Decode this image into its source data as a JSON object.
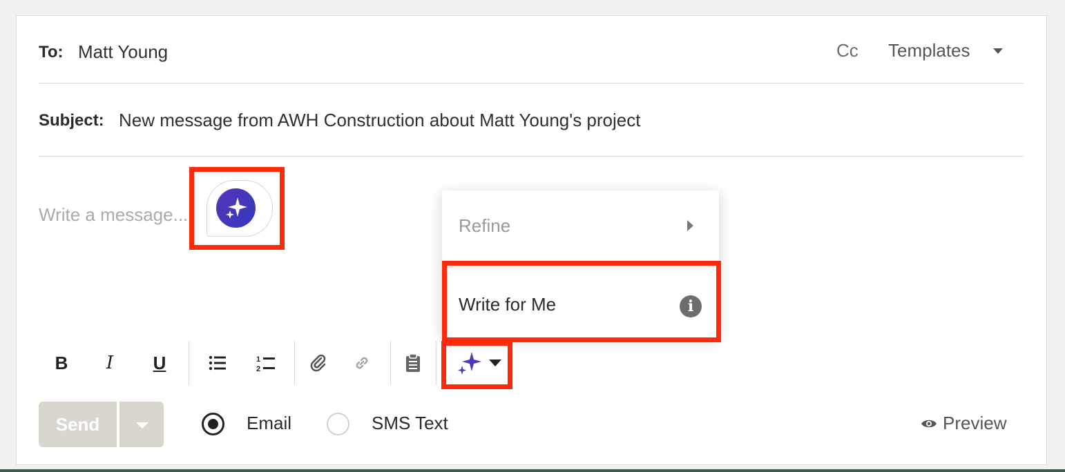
{
  "compose": {
    "to_label": "To:",
    "to_value": "Matt Young",
    "cc_label": "Cc",
    "templates_label": "Templates",
    "subject_label": "Subject:",
    "subject_value": "New message from AWH Construction about Matt Young's project",
    "body_placeholder": "Write a message..."
  },
  "ai_menu": {
    "items": [
      {
        "label": "Refine",
        "icon": "chevron-right-icon",
        "enabled": false
      },
      {
        "label": "Write for Me",
        "icon": "info-icon",
        "enabled": true
      }
    ]
  },
  "toolbar": {
    "buttons": [
      {
        "name": "bold-button",
        "glyph": "B"
      },
      {
        "name": "italic-button",
        "glyph": "I"
      },
      {
        "name": "underline-button",
        "glyph": "U"
      },
      {
        "name": "bullet-list-button",
        "icon": "bullet-list-icon"
      },
      {
        "name": "numbered-list-button",
        "icon": "numbered-list-icon"
      },
      {
        "name": "attach-button",
        "icon": "paperclip-icon"
      },
      {
        "name": "link-button",
        "icon": "link-icon"
      },
      {
        "name": "clipboard-button",
        "icon": "clipboard-icon"
      },
      {
        "name": "ai-sparkle-button",
        "icon": "sparkle-icon"
      }
    ]
  },
  "footer": {
    "send_label": "Send",
    "channel_options": [
      "Email",
      "SMS Text"
    ],
    "selected_channel": "Email",
    "preview_label": "Preview"
  },
  "colors": {
    "highlight": "#ff2a0c",
    "ai_gradient_start": "#5b33b8",
    "ai_gradient_end": "#2f3bbf",
    "send_button_disabled": "#d9d6cd"
  }
}
